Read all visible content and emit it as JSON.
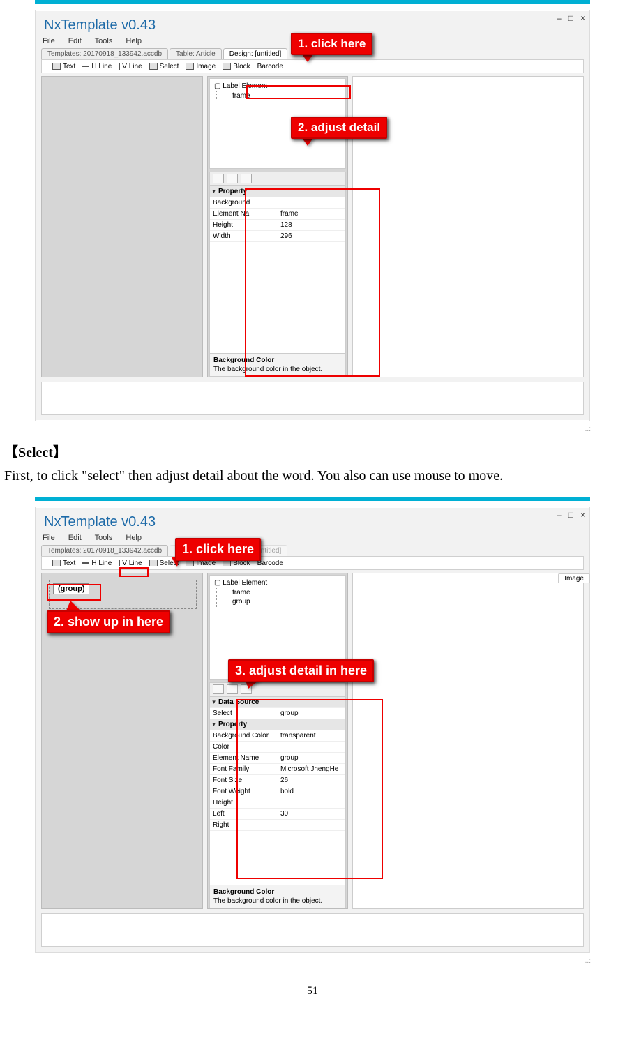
{
  "app_title": "NxTemplate v0.43",
  "winctl": {
    "min": "–",
    "max": "□",
    "close": "×"
  },
  "menu": [
    "File",
    "Edit",
    "Tools",
    "Help"
  ],
  "tabs1": [
    {
      "label": "Templates: 20170918_133942.accdb",
      "active": false
    },
    {
      "label": "Table: Article",
      "active": false
    },
    {
      "label": "Design: [untitled]",
      "active": true
    }
  ],
  "toolbar": [
    "Text",
    "H Line",
    "V Line",
    "Select",
    "Image",
    "Block",
    "Barcode"
  ],
  "shot1": {
    "tree": {
      "root": "Label Element",
      "items": [
        "frame"
      ]
    },
    "props_header": "Property",
    "props": [
      {
        "k": "Background",
        "v": ""
      },
      {
        "k": "Element Na",
        "v": "frame"
      },
      {
        "k": "Height",
        "v": "128"
      },
      {
        "k": "Width",
        "v": "296"
      }
    ],
    "desc": {
      "title": "Background Color",
      "body": "The background color in the object."
    },
    "c1": "1. click here",
    "c2": "2. adjust detail"
  },
  "section_h": "【Select】",
  "section_p": "First, to click \"select\" then adjust detail about the word. You also can use mouse to move.",
  "shot2": {
    "right_tab": "Image",
    "sel_label": "(group)",
    "tree": {
      "root": "Label Element",
      "items": [
        "frame",
        "group"
      ]
    },
    "ds_header": "Data Source",
    "ds": [
      {
        "k": "Select",
        "v": "group"
      }
    ],
    "props_header": "Property",
    "props": [
      {
        "k": "Background Color",
        "v": "transparent"
      },
      {
        "k": "Color",
        "v": ""
      },
      {
        "k": "Element Name",
        "v": "group"
      },
      {
        "k": "Font Family",
        "v": "Microsoft JhengHe"
      },
      {
        "k": "Font Size",
        "v": "26"
      },
      {
        "k": "Font Weight",
        "v": "bold"
      },
      {
        "k": "Height",
        "v": ""
      },
      {
        "k": "Left",
        "v": "30"
      },
      {
        "k": "Right",
        "v": ""
      }
    ],
    "desc": {
      "title": "Background Color",
      "body": "The background color in the object."
    },
    "c1": "1. click here",
    "c2": "2. show up in here",
    "c3": "3. adjust detail in here"
  },
  "page_num": "51"
}
